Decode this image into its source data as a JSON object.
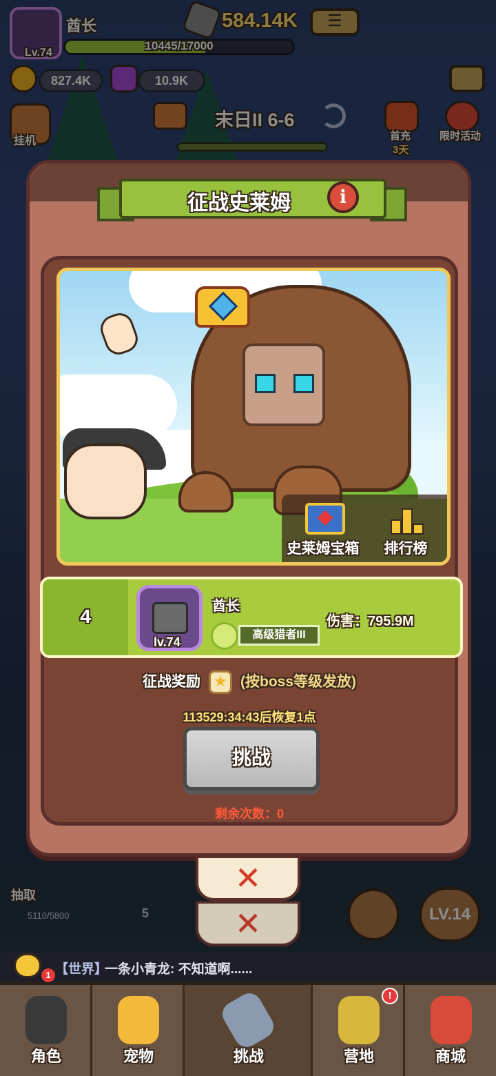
{
  "hud": {
    "player_name": "酋长",
    "player_level": "Lv.74",
    "exp_text": "10445/17000",
    "exp_progress": 0.614,
    "power": "584.14K",
    "gold": "827.4K",
    "gems": "10.9K",
    "stage": "末日II 6-6",
    "first_charge": "首充",
    "first_charge_sub": "3天",
    "limited_event": "限时活动",
    "idle": "挂机"
  },
  "dialog": {
    "title": "征战史莱姆",
    "info_icon": "i",
    "chest_label": "史莱姆宝箱",
    "ranking_label": "排行榜",
    "player": {
      "rank": "4",
      "name": "酋长",
      "level": "lv.74",
      "title": "高级猎者III",
      "damage": "伤害：795.9M"
    },
    "reward_label": "征战奖励",
    "reward_note": "(按boss等级发放)",
    "recover_text": "113529:34:43后恢复1点",
    "challenge_button": "挑战",
    "remaining": "剩余次数：0"
  },
  "background": {
    "counter_a": "5110/5800",
    "counter_b": "5",
    "level_badge": "LV.14",
    "side_label_left": "抽取"
  },
  "chat": {
    "channel": "【世界】",
    "message": "一条小青龙: 不知道啊......",
    "badge": "1"
  },
  "nav": [
    {
      "label": "角色"
    },
    {
      "label": "宠物"
    },
    {
      "label": "挑战"
    },
    {
      "label": "营地"
    },
    {
      "label": "商城"
    }
  ],
  "colors": {
    "dialog_bg": "#b77462",
    "panel_bg": "#7a4434",
    "accent_green": "#a8cc3e",
    "frame_gold": "#f0c95a",
    "alert_red": "#ff5a3a"
  },
  "icons": {
    "close": "✕",
    "menu": "☰",
    "star": "★",
    "refresh": "⟳"
  }
}
